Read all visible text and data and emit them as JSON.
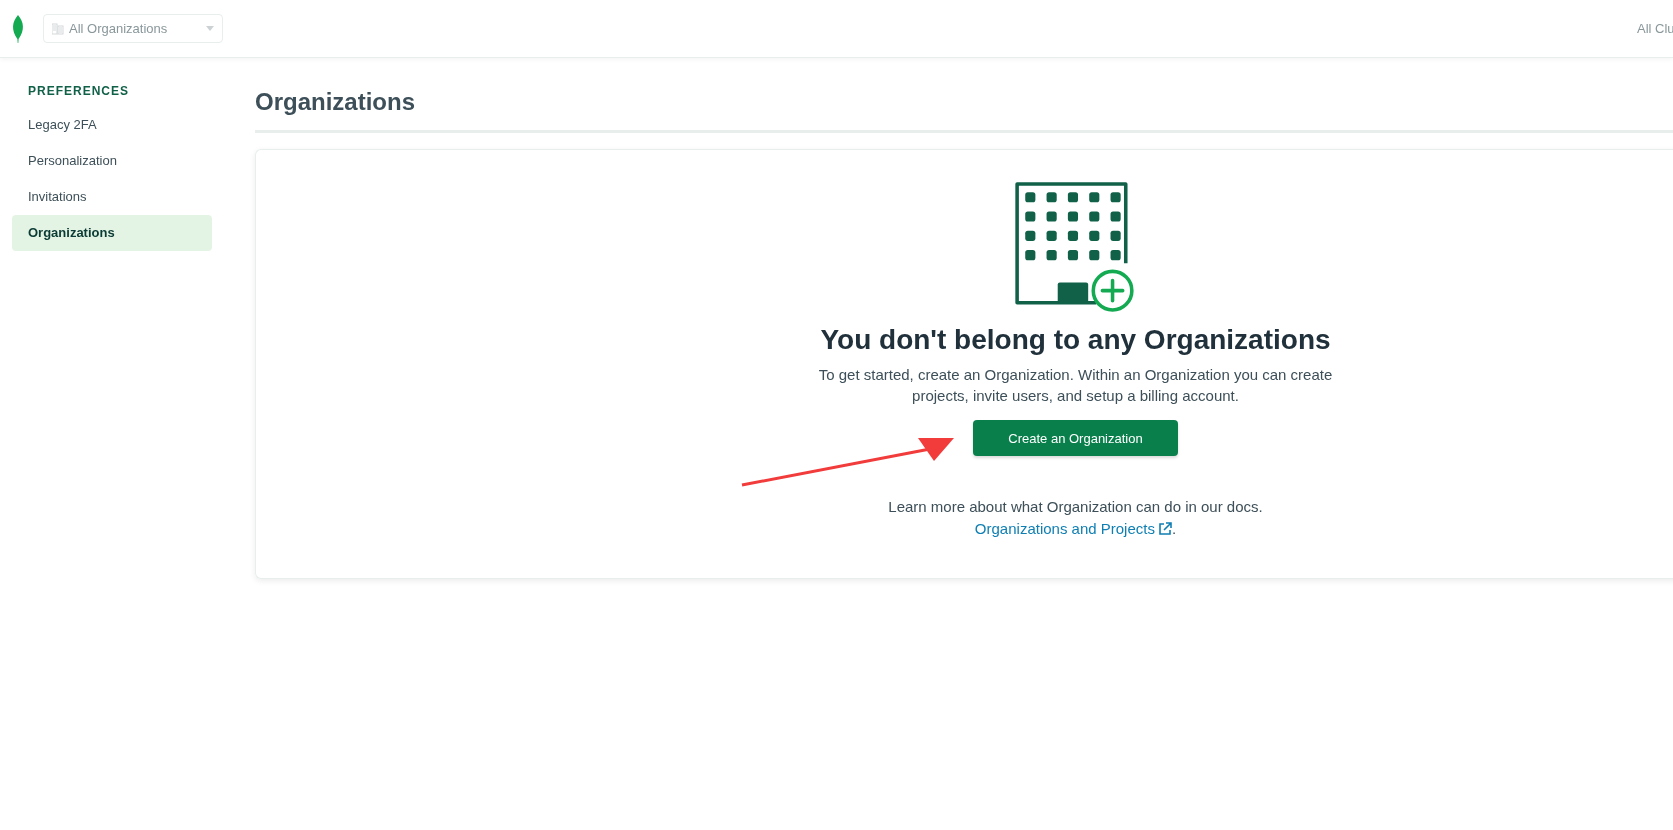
{
  "header": {
    "org_selector": {
      "placeholder": "All Organizations"
    },
    "right_link": "All Clu"
  },
  "sidebar": {
    "heading": "PREFERENCES",
    "items": [
      {
        "label": "Legacy 2FA",
        "selected": false
      },
      {
        "label": "Personalization",
        "selected": false
      },
      {
        "label": "Invitations",
        "selected": false
      },
      {
        "label": "Organizations",
        "selected": true
      }
    ]
  },
  "page_title": "Organizations",
  "empty_state": {
    "title": "You don't belong to any Organizations",
    "description": "To get started, create an Organization. Within an Organization you can create projects, invite users, and setup a billing account.",
    "button": "Create an Organization",
    "learn_more": "Learn more about what Organization can do in our docs.",
    "docs_link": "Organizations and Projects",
    "docs_link_suffix": "."
  }
}
